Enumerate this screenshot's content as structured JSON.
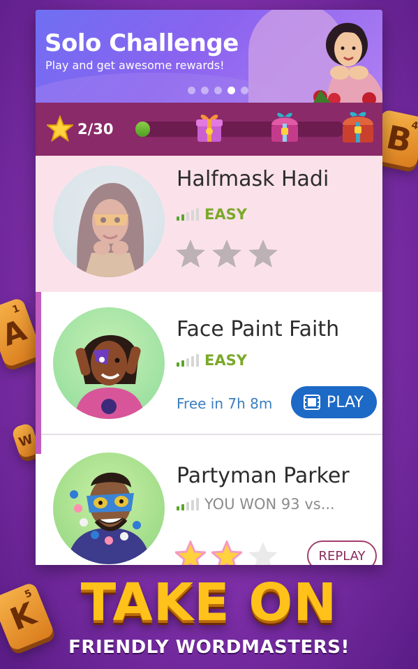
{
  "banner": {
    "title": "Solo Challenge",
    "subtitle": "Play and get awesome rewards!",
    "dots": 5,
    "active_dot": 3
  },
  "progress": {
    "count_label": "2/30",
    "value": 2,
    "max": 30,
    "rewards": [
      "gift-box-icon",
      "treasure-chest-icon",
      "treasure-chest-large-icon"
    ]
  },
  "opponents": [
    {
      "name": "Halfmask Hadi",
      "difficulty": "EASY",
      "difficulty_level": 2,
      "stars_earned": 0,
      "stars_total": 3,
      "status": "completed"
    },
    {
      "name": "Face Paint Faith",
      "difficulty": "EASY",
      "difficulty_level": 2,
      "free_text": "Free in 7h 8m",
      "action_label": "PLAY",
      "status": "active"
    },
    {
      "name": "Partyman Parker",
      "difficulty_level": 2,
      "result_text": "YOU WON 93 vs...",
      "stars_earned": 2,
      "stars_total": 3,
      "action_label": "REPLAY",
      "status": "won"
    }
  ],
  "tiles": [
    {
      "letter": "B",
      "points": "4"
    },
    {
      "letter": "A",
      "points": "1"
    },
    {
      "letter": "W",
      "points": ""
    },
    {
      "letter": "K",
      "points": "5"
    }
  ],
  "promo": {
    "title": "TAKE ON",
    "subtitle": "FRIENDLY WORDMASTERS!"
  },
  "colors": {
    "background": "#8a3cb4",
    "progress_bar": "#8a2a68",
    "play_button": "#1d69c6",
    "easy": "#7ba92a",
    "promo_title": "#ffc21a"
  }
}
